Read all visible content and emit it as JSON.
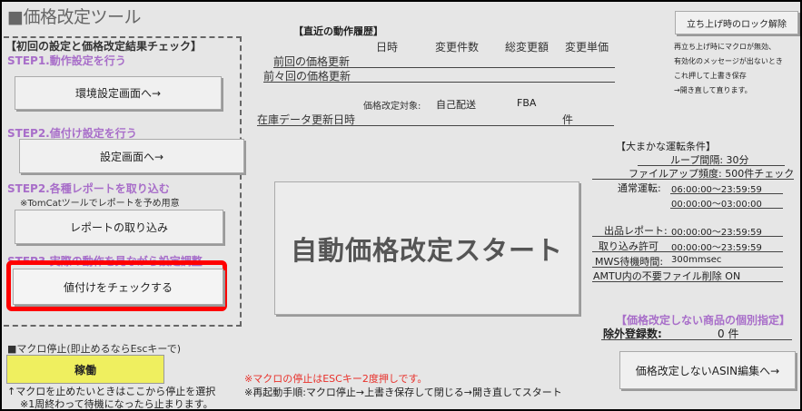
{
  "app": {
    "title": "■価格改定ツール"
  },
  "left": {
    "header": "【初回の設定と価格改定結果チェック】",
    "step1": {
      "label": "STEP1.動作設定を行う",
      "button": "環境設定画面へ→"
    },
    "step2a": {
      "label": "STEP2.値付け設定を行う",
      "button": "設定画面へ→"
    },
    "step2b": {
      "label": "STEP2.各種レポートを取り込む",
      "note": "※TomCatツールでレポートを予め用意",
      "button": "レポートの取り込み"
    },
    "step3": {
      "label": "STEP3.実際の動作を見ながら設定調整",
      "button": "値付けをチェックする"
    }
  },
  "macro": {
    "label": "■マクロ停止(即止めるならEscキーで)",
    "button": "稼働",
    "note1": "↑マクロを止めたいときはここから停止を選択",
    "note2": "※1周終わって待機になったら止まります。"
  },
  "history": {
    "title": "【直近の動作履歴】",
    "columns": [
      "日時",
      "変更件数",
      "総変更額",
      "変更単価"
    ],
    "rows": [
      "前回の価格更新",
      "前々回の価格更新"
    ],
    "target_label": "価格改定対象:",
    "target_self": "自己配送",
    "target_fba": "FBA",
    "stock_label": "在庫データ更新日時",
    "stock_unit": "件"
  },
  "start_button": "自動価格改定スタート",
  "unlock": {
    "button": "立ち上げ時のロック解除",
    "notes": [
      "再立ち上げ時にマクロが無効、",
      "有効化のメッセージが出ないとき",
      "これ押して上書き保存",
      "→開き直して直ります。"
    ]
  },
  "conditions": {
    "title": "【大まかな運転条件】",
    "loop": "ループ間隔: 30分",
    "fileup": "ファイルアップ頻度: 500件チェック",
    "normal_label": "通常運転:",
    "normal_1": "06:00:00〜23:59:59",
    "normal_2": "00:00:00〜03:00:00",
    "listing_label": "出品レポート:",
    "listing_val": "00:00:00〜23:59:59",
    "import_label": "取り込み許可",
    "import_val": "00:00:00〜23:59:59",
    "mws_label": "MWS待機時間:",
    "mws_val": "300mmsec",
    "amtu": "AMTU内の不要ファイル削除 ON"
  },
  "exclude": {
    "title": "【価格改定しない商品の個別指定】",
    "label": "除外登録数:",
    "value": "0 件",
    "button": "価格改定しないASIN編集へ→"
  },
  "footer": {
    "red_note": "※マクロの停止はESCキー2度押しです。",
    "restart_note": "※再起動手順:マクロ停止→上書き保存して閉じる→開き直してスタート"
  }
}
